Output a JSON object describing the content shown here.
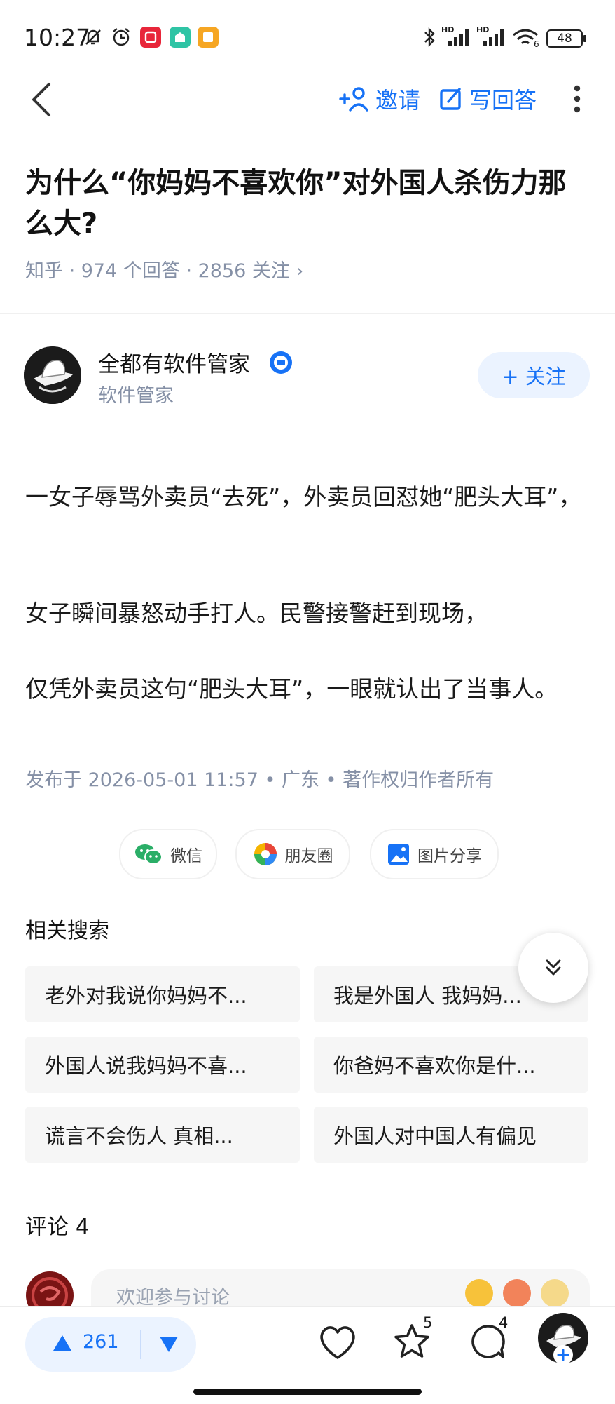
{
  "status_bar": {
    "time": "10:27",
    "battery": "48",
    "hd1": "HD",
    "hd2": "HD",
    "wifi_sub": "6"
  },
  "nav": {
    "invite_label": "邀请",
    "write_answer_label": "写回答"
  },
  "question": {
    "title": "为什么“你妈妈不喜欢你”对外国人杀伤力那么大?",
    "meta": "知乎 · 974  个回答 · 2856  关注 ›"
  },
  "author": {
    "name": "全都有软件管家",
    "subtitle": "软件管家",
    "follow_label": "+ 关注"
  },
  "answer": {
    "paragraphs": [
      "一女子辱骂外卖员“去死”，外卖员回怼她“肥头大耳”，",
      "女子瞬间暴怒动手打人。民警接警赶到现场，",
      "仅凭外卖员这句“肥头大耳”，一眼就认出了当事人。"
    ],
    "publish_info": "发布于  2026-05-01  11:57 • 广东 • 著作权归作者所有"
  },
  "share": {
    "wechat": "微信",
    "moments": "朋友圈",
    "image_share": "图片分享"
  },
  "related": {
    "title": "相关搜索",
    "items": [
      "老外对我说你妈妈不...",
      "我是外国人  我妈妈...",
      "外国人说我妈妈不喜...",
      "你爸妈不喜欢你是什...",
      "谎言不会伤人  真相...",
      "外国人对中国人有偏见"
    ]
  },
  "comments": {
    "title": "评论  4",
    "placeholder": "欢迎参与讨论"
  },
  "bottom": {
    "upvotes": "261",
    "favorites_count": "5",
    "comments_count": "4"
  },
  "colors": {
    "accent": "#1772f6",
    "meta": "#8590a6",
    "chip_bg": "#f6f6f6"
  }
}
